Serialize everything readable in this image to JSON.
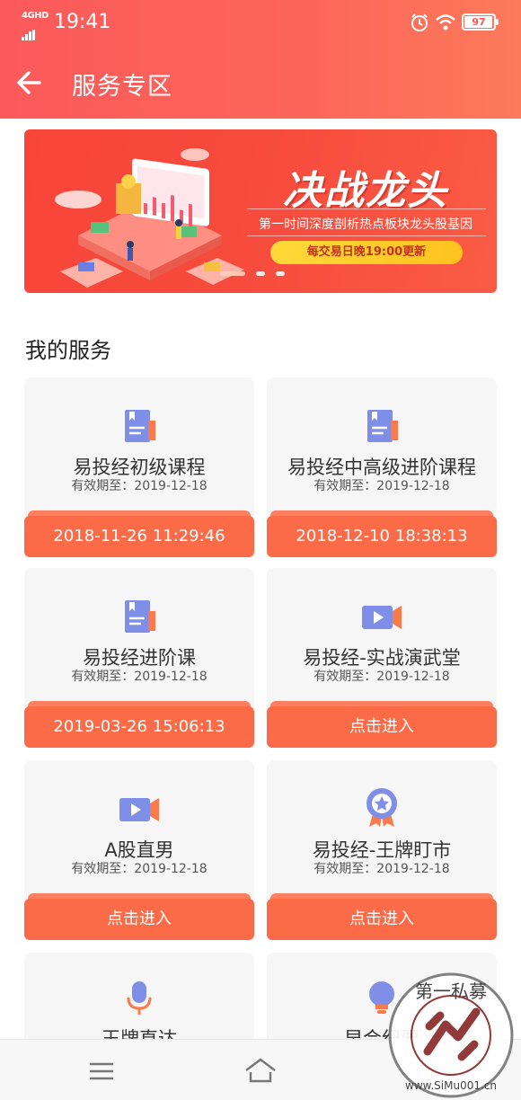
{
  "status_bar": {
    "network": "4GHD",
    "time": "19:41",
    "battery": "97"
  },
  "header": {
    "back_icon": "arrow-left-icon",
    "title": "服务专区"
  },
  "banner": {
    "headline": "决战龙头",
    "subtitle": "第一时间深度剖析热点板块龙头股基因",
    "pill_text": "每交易日晚19:00更新",
    "slide_count": 3,
    "active_slide": 1
  },
  "section": {
    "title": "我的服务"
  },
  "services": [
    {
      "name": "易投经初级课程",
      "valid": "有效期至：2019-12-18",
      "action": "2018-11-26 11:29:46",
      "icon": "book-icon"
    },
    {
      "name": "易投经中高级进阶课程",
      "valid": "有效期至：2019-12-18",
      "action": "2018-12-10 18:38:13",
      "icon": "book-icon"
    },
    {
      "name": "易投经进阶课",
      "valid": "有效期至：2019-12-18",
      "action": "2019-03-26 15:06:13",
      "icon": "book-icon"
    },
    {
      "name": "易投经-实战演武堂",
      "valid": "有效期至：2019-12-18",
      "action": "点击进入",
      "icon": "video-camera-icon"
    },
    {
      "name": "A股直男",
      "valid": "有效期至：2019-12-18",
      "action": "点击进入",
      "icon": "video-camera-icon"
    },
    {
      "name": "易投经-王牌盯市",
      "valid": "有效期至：2019-12-18",
      "action": "点击进入",
      "icon": "medal-icon"
    },
    {
      "name": "王牌直达",
      "icon": "microphone-icon"
    },
    {
      "name": "早会纪要",
      "icon": "lightbulb-icon"
    }
  ],
  "bottom_nav": {
    "menu_icon": "menu-icon",
    "home_icon": "home-icon"
  },
  "watermark": {
    "text_top": "第一私募",
    "text_bottom": "www.SiMu001.cn",
    "icon": "watermark-seal-icon"
  },
  "colors": {
    "header": "#fb5a5a",
    "accent_button": "#fb6b47",
    "card_bg": "#f6f6f6",
    "icon_purple": "#7f8ee6",
    "icon_orange": "#fb7a4c"
  }
}
